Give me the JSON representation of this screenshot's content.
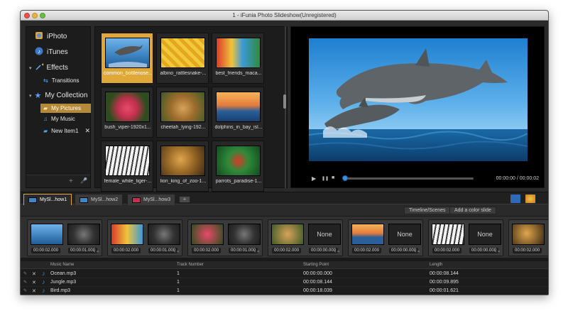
{
  "window": {
    "title": "1 - iFunia Photo Slideshow(Unregistered)"
  },
  "sidebar": {
    "items": [
      {
        "label": "iPhoto",
        "icon": "iphoto-icon"
      },
      {
        "label": "iTunes",
        "icon": "itunes-icon"
      },
      {
        "label": "Effects",
        "icon": "effects-wand-icon"
      },
      {
        "label": "Transitions",
        "icon": "transitions-icon"
      },
      {
        "label": "My Collection",
        "icon": "star-icon"
      },
      {
        "label": "My Pictures",
        "icon": "folder-icon",
        "selected": true
      },
      {
        "label": "My Music",
        "icon": "music-note-icon"
      },
      {
        "label": "New Item1",
        "icon": "folder-icon"
      }
    ],
    "add": "+",
    "mic": "🎤"
  },
  "media": [
    {
      "caption": "common_bottlenose...",
      "selected": true
    },
    {
      "caption": "albino_rattlesnake-..."
    },
    {
      "caption": "best_friends_maca..."
    },
    {
      "caption": "bush_viper-1920x1..."
    },
    {
      "caption": "cheetah_lying-192..."
    },
    {
      "caption": "dolphins_in_bay_isl..."
    },
    {
      "caption": "female_while_tiger-..."
    },
    {
      "caption": "lion_king_of_zoo-1..."
    },
    {
      "caption": "parrots_paradise-1..."
    }
  ],
  "preview": {
    "time": "00:00:00 / 00:00:02",
    "play": "▶",
    "pause": "❚❚",
    "stop": "■"
  },
  "tabs": [
    {
      "label": "MySl...how1",
      "active": true
    },
    {
      "label": "MySl...how2"
    },
    {
      "label": "MySl...how3"
    }
  ],
  "tab_add": "+",
  "toolbar": {
    "timeline_scenes": "Timeline/Scenes",
    "add_color_slide": "Add a color slide"
  },
  "timeline": [
    {
      "clip": "00:00:02.000",
      "trans": "00:00:01.000",
      "label": ""
    },
    {
      "clip": "00:00:02.000",
      "trans": "00:00:01.000",
      "label": ""
    },
    {
      "clip": "00:00:02.000",
      "trans": "00:00:01.000",
      "label": ""
    },
    {
      "clip": "00:00:02.000",
      "trans": "00:00:00.000",
      "label": "None"
    },
    {
      "clip": "00:00:02.000",
      "trans": "00:00:00.000",
      "label": "None"
    },
    {
      "clip": "00:00:02.000",
      "trans": "00:00:00.000",
      "label": "None"
    },
    {
      "clip": "00:00:02.000",
      "trans": "",
      "label": ""
    }
  ],
  "music": {
    "headers": [
      "Music Name",
      "Track Number",
      "Starting Point",
      "Length"
    ],
    "rows": [
      {
        "name": "Ocean.mp3",
        "track": "1",
        "start": "00:00:00.000",
        "length": "00:00:08.144"
      },
      {
        "name": "Jungle.mp3",
        "track": "1",
        "start": "00:00:08.144",
        "length": "00:00:09.895"
      },
      {
        "name": "Bird.mp3",
        "track": "1",
        "start": "00:00:18.039",
        "length": "00:00:01.621"
      }
    ]
  },
  "colors": {
    "accent": "#e0a838",
    "selection": "#b5893a",
    "blue": "#3f8fd8"
  }
}
